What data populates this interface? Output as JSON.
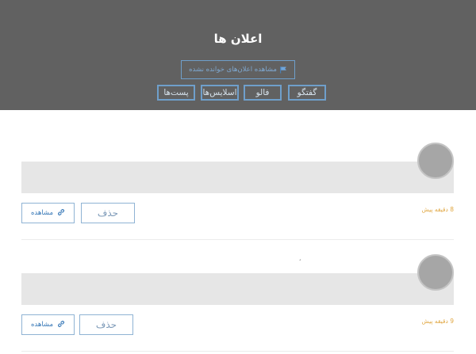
{
  "header": {
    "title": "اعلان ها",
    "unread_button": "مشاهده اعلان‌های خوانده نشده",
    "unread_icon": "flag-icon",
    "filters": [
      "گفتگو",
      "فالو",
      "اسلایس‌ها",
      "پست‌ها"
    ]
  },
  "notifications": [
    {
      "time": "8 دقیقه پیش",
      "delete_label": "حذف",
      "view_label": "مشاهده",
      "view_icon": "link-icon"
    },
    {
      "time": "9 دقیقه پیش",
      "delete_label": "حذف",
      "view_label": "مشاهده",
      "view_icon": "link-icon",
      "mark": "ˊ"
    }
  ],
  "colors": {
    "header_bg": "#616161",
    "accent": "#6f9fcb",
    "time": "#e0a640",
    "box": "#e6e6e6"
  }
}
